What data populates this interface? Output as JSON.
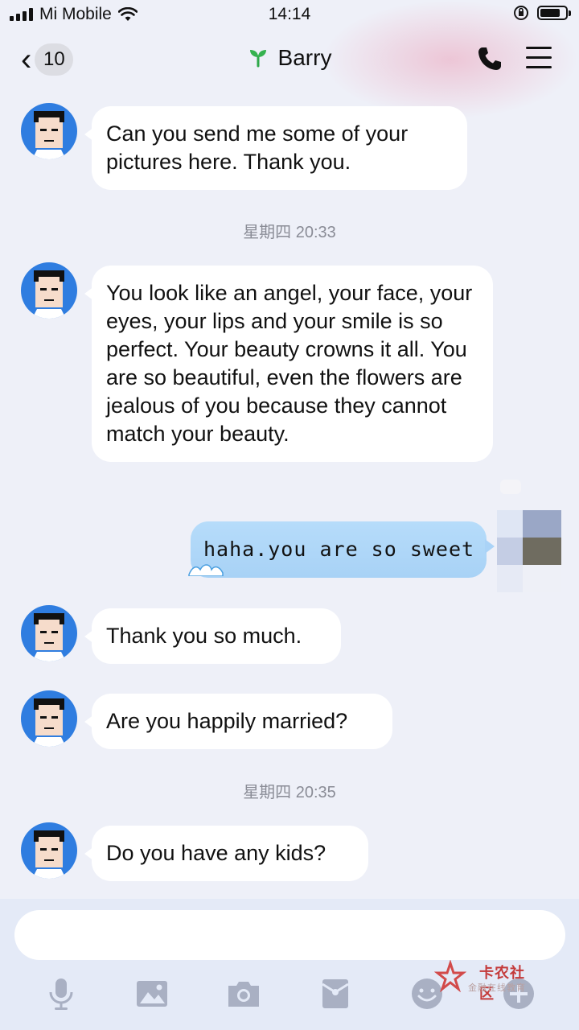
{
  "status": {
    "carrier": "Mi Mobile",
    "time": "14:14",
    "battery_level": 0.8
  },
  "header": {
    "back_count": "10",
    "contact_name": "Barry"
  },
  "messages": [
    {
      "text": "Can you send me some of your pictures here. Thank you."
    },
    {
      "timestamp": "星期四 20:33"
    },
    {
      "text": "You look like an angel, your face, your eyes, your lips and your smile is so perfect. Your beauty crowns it all. You are so beautiful, even the flowers are jealous of you because they cannot match your beauty."
    },
    {
      "text": "haha.you are so sweet"
    },
    {
      "text": "Thank you so much."
    },
    {
      "text": "Are you happily married?"
    },
    {
      "timestamp": "星期四 20:35"
    },
    {
      "text": "Do you have any kids?"
    }
  ],
  "input": {
    "placeholder": ""
  },
  "toolbar": {
    "icons": [
      "microphone-icon",
      "image-icon",
      "camera-icon",
      "red-packet-icon",
      "emoji-icon",
      "plus-icon"
    ]
  },
  "watermark": {
    "title": "卡农社区",
    "subtitle": "金融在线教育"
  }
}
